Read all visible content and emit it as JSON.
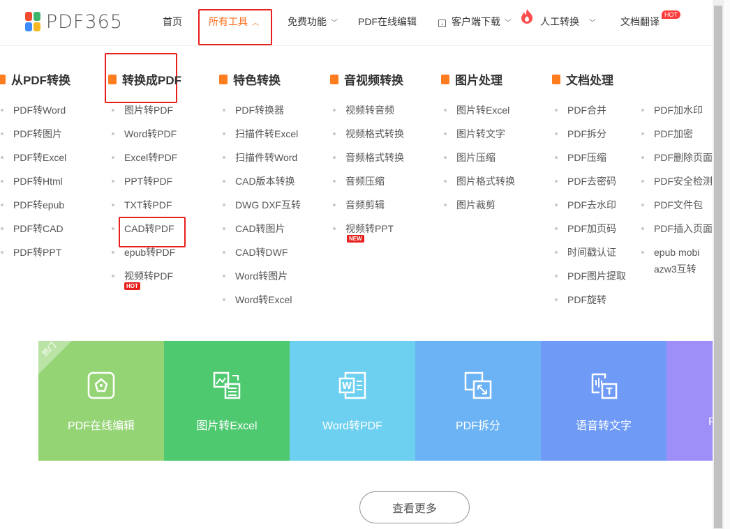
{
  "brand": {
    "name": "PDF365",
    "colors": [
      "#f04c2f",
      "#3eb56c",
      "#3d8bfd",
      "#f6b822"
    ]
  },
  "nav": {
    "home": "首页",
    "all_tools": "所有工具",
    "free": "免费功能",
    "online_edit": "PDF在线编辑",
    "download": "客户端下载",
    "manual": "人工转换",
    "translate": "文档翻译",
    "hot": "HOT"
  },
  "categories": [
    {
      "title": "从PDF转换",
      "items": [
        "PDF转Word",
        "PDF转图片",
        "PDF转Excel",
        "PDF转Html",
        "PDF转epub",
        "PDF转CAD",
        "PDF转PPT"
      ]
    },
    {
      "title": "转换成PDF",
      "items": [
        "图片转PDF",
        "Word转PDF",
        "Excel转PDF",
        "PPT转PDF",
        "TXT转PDF",
        "CAD转PDF",
        "epub转PDF",
        "视频转PDF"
      ],
      "badge": "HOT"
    },
    {
      "title": "特色转换",
      "items": [
        "PDF转换器",
        "扫描件转Excel",
        "扫描件转Word",
        "CAD版本转换",
        "DWG DXF互转",
        "CAD转图片",
        "CAD转DWF",
        "Word转图片",
        "Word转Excel"
      ]
    },
    {
      "title": "音视频转换",
      "items": [
        "视频转音频",
        "视频格式转换",
        "音频格式转换",
        "音频压缩",
        "音频剪辑",
        "视频转PPT"
      ],
      "badge": "NEW"
    },
    {
      "title": "图片处理",
      "items": [
        "图片转Excel",
        "图片转文字",
        "图片压缩",
        "图片格式转换",
        "图片裁剪"
      ]
    },
    {
      "title": "文档处理",
      "items": [
        "PDF合并",
        "PDF拆分",
        "PDF压缩",
        "PDF去密码",
        "PDF去水印",
        "PDF加页码",
        "时间戳认证",
        "PDF图片提取",
        "PDF旋转"
      ],
      "items2": [
        "PDF加水印",
        "PDF加密",
        "PDF删除页面",
        "PDF安全检测",
        "PDF文件包",
        "PDF插入页面",
        "epub mobi",
        "azw3互转"
      ]
    }
  ],
  "tiles": {
    "hot_ribbon": "热门",
    "items": [
      {
        "label": "PDF在线编辑",
        "color": "#95d475"
      },
      {
        "label": "图片转Excel",
        "color": "#4ec970"
      },
      {
        "label": "Word转PDF",
        "color": "#6ed0f0"
      },
      {
        "label": "PDF拆分",
        "color": "#6cb3f5"
      },
      {
        "label": "语音转文字",
        "color": "#6f9bf6"
      },
      {
        "label": "P",
        "color": "#9d8ff7"
      }
    ]
  },
  "more_button": "查看更多"
}
